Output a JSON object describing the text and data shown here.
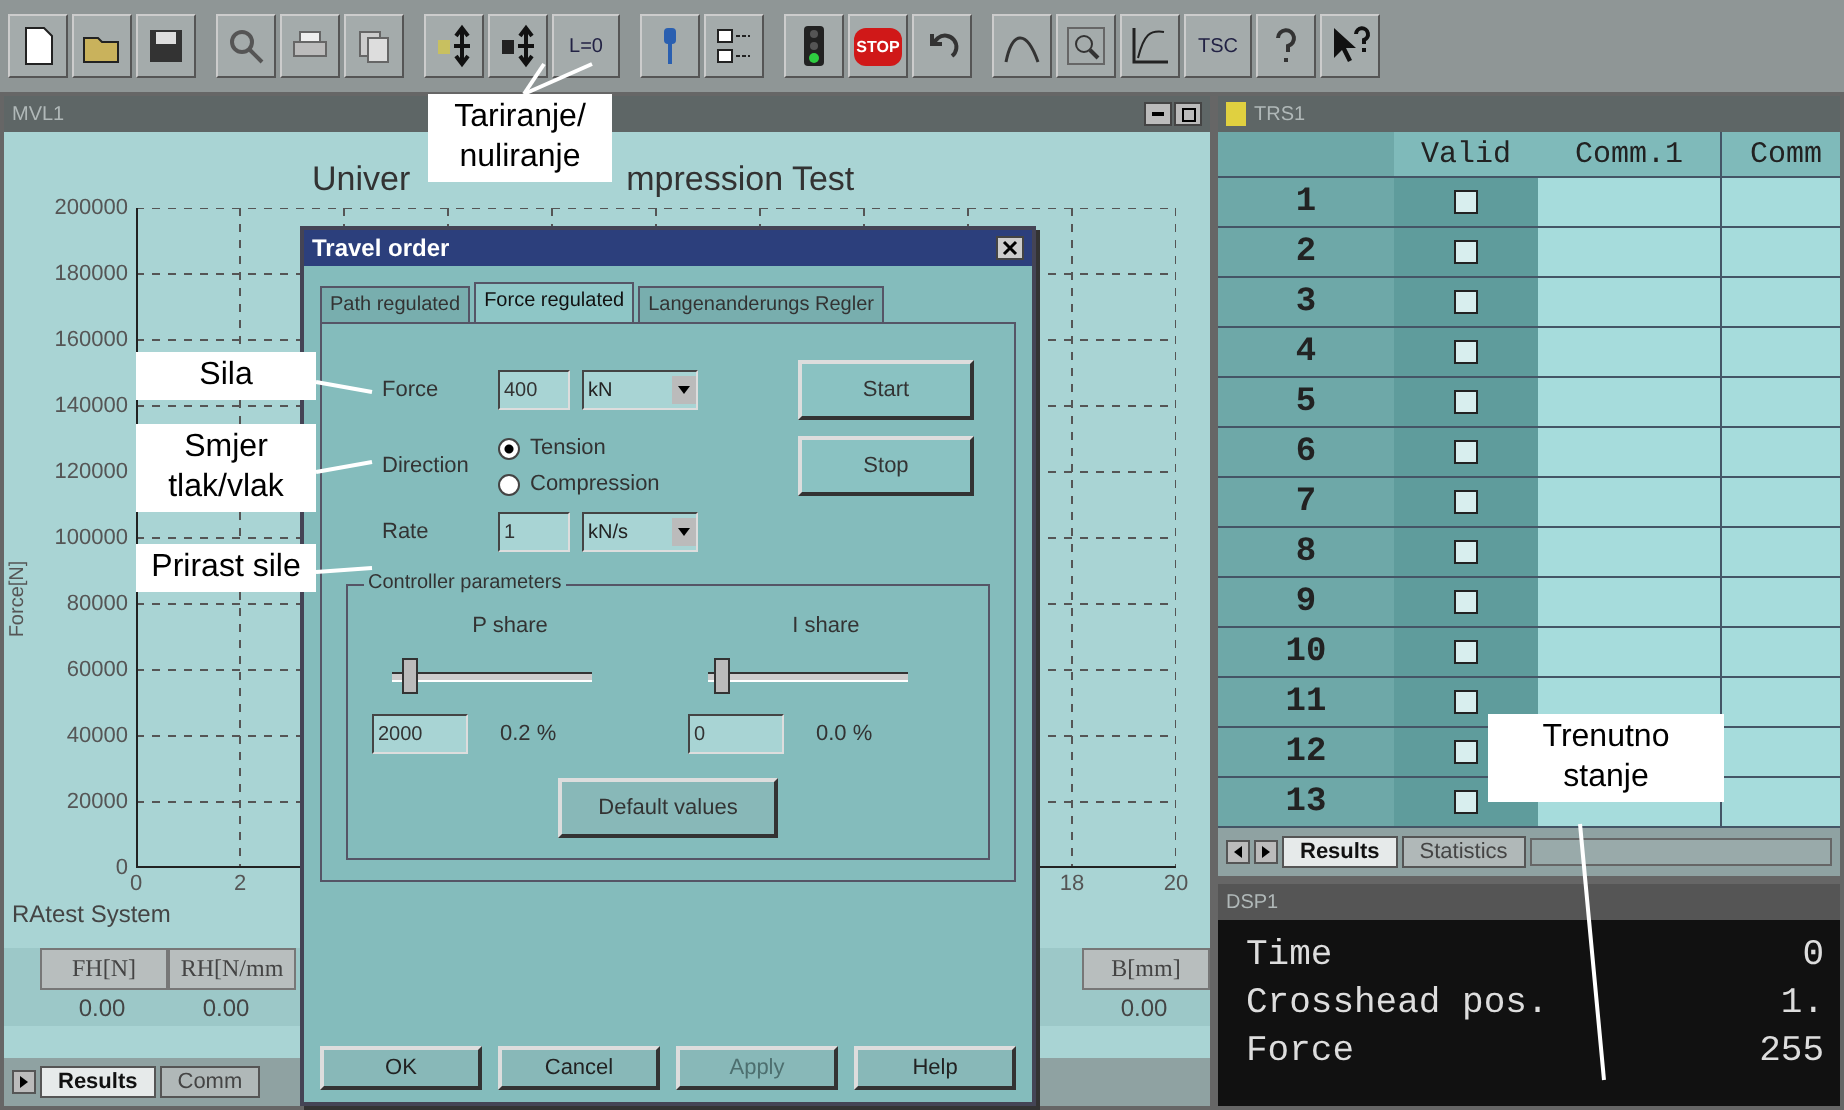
{
  "toolbar": {
    "labels": [
      "L=0",
      "STOP",
      "TSC"
    ]
  },
  "chart_window": {
    "title": "MVL1",
    "chart_title_start": "Univer",
    "chart_title_end": "mpression Test",
    "ylabel": "Force[N]",
    "y_ticks": [
      "200000",
      "180000",
      "160000",
      "140000",
      "120000",
      "100000",
      "80000",
      "60000",
      "40000",
      "20000",
      "0"
    ],
    "x_ticks_start": [
      "0",
      "2"
    ],
    "x_ticks_end": [
      "18",
      "20"
    ],
    "system_label": "RAtest System",
    "results_left": {
      "columns": [
        "FH[N]",
        "RH[N/mm"
      ],
      "values": [
        "0.00",
        "0.00"
      ]
    },
    "results_right": {
      "columns": [
        "B[mm]"
      ],
      "values": [
        "0.00"
      ]
    },
    "tabs": [
      {
        "label": "Results",
        "selected": true
      },
      {
        "label": "Comm",
        "selected": false
      }
    ]
  },
  "dialog": {
    "title": "Travel order",
    "tabs": [
      {
        "label": "Path regulated",
        "selected": false
      },
      {
        "label": "Force regulated",
        "selected": true
      },
      {
        "label": "Langenanderungs Regler",
        "selected": false
      }
    ],
    "force": {
      "label": "Force",
      "value": "400",
      "unit": "kN"
    },
    "direction": {
      "label": "Direction",
      "options": [
        {
          "label": "Tension",
          "selected": true
        },
        {
          "label": "Compression",
          "selected": false
        }
      ]
    },
    "rate": {
      "label": "Rate",
      "value": "1",
      "unit": "kN/s"
    },
    "start": "Start",
    "stop": "Stop",
    "controller": {
      "title": "Controller parameters",
      "sliders": [
        {
          "label": "P share",
          "level": 0.05,
          "value": "2000",
          "percent": "0.2 %"
        },
        {
          "label": "I share",
          "level": 0.03,
          "value": "0",
          "percent": "0.0 %"
        }
      ],
      "default_button": "Default values"
    },
    "buttons": [
      {
        "label": "OK",
        "disabled": false
      },
      {
        "label": "Cancel",
        "disabled": false
      },
      {
        "label": "Apply",
        "disabled": true
      },
      {
        "label": "Help",
        "disabled": false
      }
    ]
  },
  "table_window": {
    "title": "TRS1",
    "columns": [
      "Valid",
      "Comm.1",
      "Comm"
    ],
    "rows": [
      {
        "number": "1",
        "checked": false
      },
      {
        "number": "2",
        "checked": false
      },
      {
        "number": "3",
        "checked": false
      },
      {
        "number": "4",
        "checked": false
      },
      {
        "number": "5",
        "checked": false
      },
      {
        "number": "6",
        "checked": false
      },
      {
        "number": "7",
        "checked": false
      },
      {
        "number": "8",
        "checked": false
      },
      {
        "number": "9",
        "checked": false
      },
      {
        "number": "10",
        "checked": false
      },
      {
        "number": "11",
        "checked": false
      },
      {
        "number": "12",
        "checked": false
      },
      {
        "number": "13",
        "checked": false
      }
    ],
    "tabs": [
      {
        "label": "Results",
        "selected": true
      },
      {
        "label": "Statistics",
        "selected": false
      }
    ]
  },
  "display_window": {
    "title": "DSP1",
    "rows": [
      {
        "label": "Time",
        "value": "0"
      },
      {
        "label": "Crosshead pos.",
        "value": "1."
      },
      {
        "label": "Force",
        "value": "255"
      }
    ]
  },
  "callouts": [
    {
      "lines": [
        "Tariranje/",
        "nuliranje"
      ]
    },
    {
      "lines": [
        "Sila"
      ]
    },
    {
      "lines": [
        "Smjer",
        "tlak/vlak"
      ]
    },
    {
      "lines": [
        "Prirast sile"
      ]
    },
    {
      "lines": [
        "Trenutno",
        "stanje"
      ]
    }
  ]
}
